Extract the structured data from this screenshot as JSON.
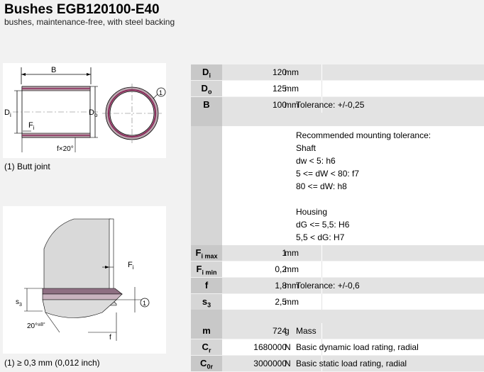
{
  "header": {
    "title": "Bushes EGB120100-E40",
    "subtitle": "bushes, maintenance-free, with steel backing"
  },
  "drawing1": {
    "labels": {
      "B": "B",
      "Di": "D",
      "Di_sub": "i",
      "Do": "D",
      "Do_sub": "o",
      "Fi": "F",
      "Fi_sub": "i",
      "chamfer": "f×20°",
      "joint": "1"
    },
    "caption": "(1) Butt joint"
  },
  "drawing2": {
    "labels": {
      "Fi": "F",
      "Fi_sub": "i",
      "s3": "s",
      "s3_sub": "3",
      "angle": "20°",
      "angle_tol": "±8°",
      "f": "f",
      "joint": "1"
    },
    "caption": "(1) ≥ 0,3 mm (0,012 inch)"
  },
  "specs": {
    "di": {
      "sym": "D",
      "sub": "i",
      "value": "120",
      "unit": "mm",
      "desc": ""
    },
    "do": {
      "sym": "D",
      "sub": "o",
      "value": "125",
      "unit": "mm",
      "desc": ""
    },
    "b": {
      "sym": "B",
      "sub": "",
      "value": "100",
      "unit": "mm",
      "desc": "Tolerance: +/-0,25"
    },
    "fimax": {
      "sym": "F",
      "sub": "i max",
      "value": "1",
      "unit": "mm",
      "desc": ""
    },
    "fimin": {
      "sym": "F",
      "sub": "i min",
      "value": "0,2",
      "unit": "mm",
      "desc": ""
    },
    "f": {
      "sym": "f",
      "sub": "",
      "value": "1,8",
      "unit": "mm",
      "desc": "Tolerance: +/-0,6"
    },
    "s3": {
      "sym": "s",
      "sub": "3",
      "value": "2,5",
      "unit": "mm",
      "desc": ""
    },
    "m": {
      "sym": "m",
      "sub": "",
      "value": "724",
      "unit": "g",
      "desc": "Mass"
    },
    "cr": {
      "sym": "C",
      "sub": "r",
      "value": "1680000",
      "unit": "N",
      "desc": "Basic dynamic load rating, radial"
    },
    "c0r": {
      "sym": "C",
      "sub": "0r",
      "value": "3000000",
      "unit": "N",
      "desc": "Basic static load rating, radial"
    }
  },
  "mounting": {
    "l1": "Recommended mounting tolerance:",
    "l2": "Shaft",
    "l3": "dw < 5: h6",
    "l4": "5 <= dW < 80: f7",
    "l5": "80 <= dW: h8",
    "l6": "",
    "l7": "Housing",
    "l8": "dG <= 5,5: H6",
    "l9": "5,5 < dG: H7"
  }
}
